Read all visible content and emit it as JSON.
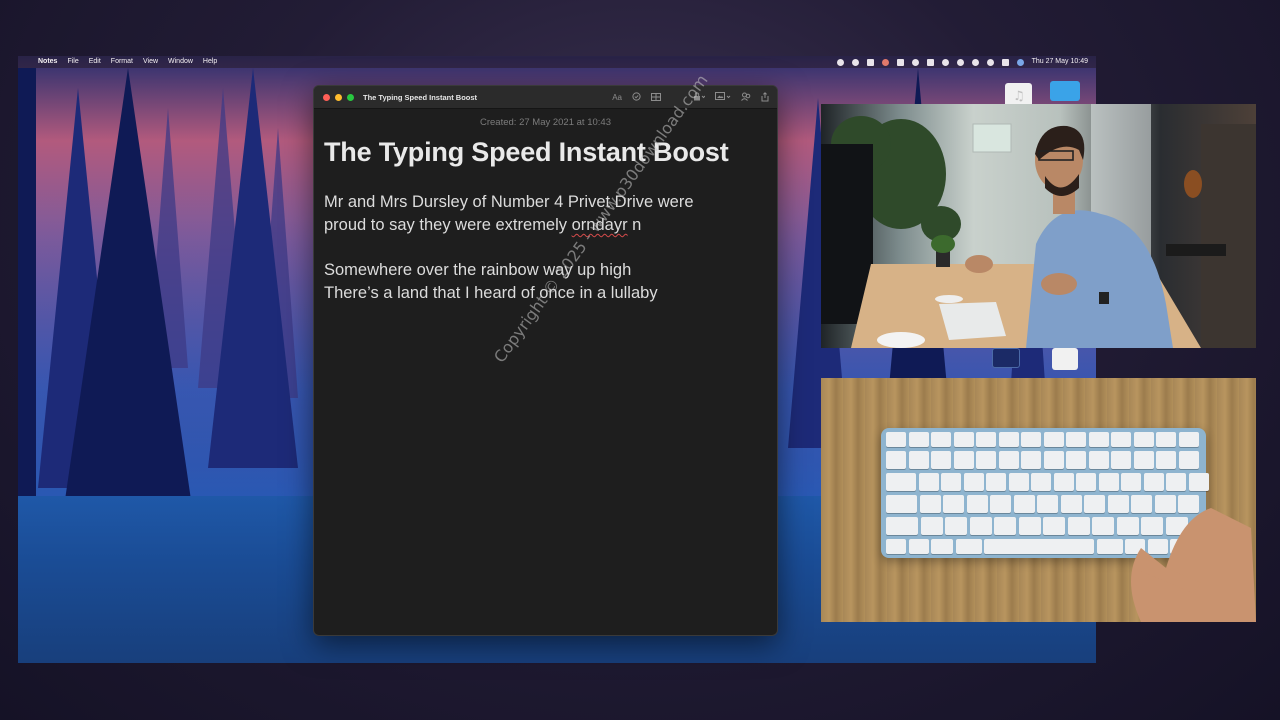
{
  "menubar": {
    "app_name": "Notes",
    "menus": [
      "File",
      "Edit",
      "Format",
      "View",
      "Window",
      "Help"
    ],
    "clock": "Thu 27 May  10:49"
  },
  "notes_window": {
    "title": "The Typing Speed Instant Boost",
    "created": "Created: 27 May 2021 at 10:43",
    "toolbar_icons": [
      "font-icon",
      "checklist-icon",
      "table-icon",
      "lock-icon",
      "media-icon",
      "share-people-icon",
      "share-icon"
    ],
    "font_button_label": "Aa",
    "note": {
      "heading": "The Typing Speed Instant Boost",
      "para1_line1": "Mr and Mrs Dursley of Number 4 Privet Drive were",
      "para1_line2_start": "proud to say they were extremely ",
      "para1_misspelled": "orndayr",
      "para1_line2_end": " n",
      "para2_line1": "Somewhere over the rainbow way up high",
      "para2_line2": "There’s a land that I heard of once in a lullaby"
    }
  },
  "watermark": "Copyright © 2025 - www.p30download.com",
  "colors": {
    "close": "#ff5f57",
    "minimize": "#febc2e",
    "zoom": "#28c840",
    "note_bg": "#1e1e1e",
    "folder_blue": "#3aa3e8"
  }
}
